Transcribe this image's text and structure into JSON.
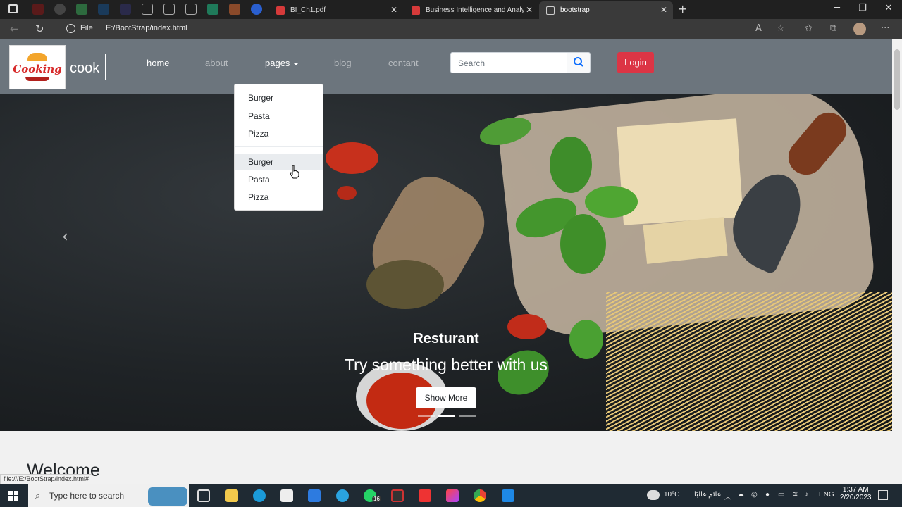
{
  "browser": {
    "tabs": [
      {
        "title": "BI_Ch1.pdf"
      },
      {
        "title": "Business Intelligence and Analytic"
      },
      {
        "title": "bootstrap"
      }
    ],
    "file_label": "File",
    "url": "E:/BootStrap/index.html",
    "status_url": "file:///E:/BootStrap/index.html#"
  },
  "navbar": {
    "brand": "cook",
    "logo_text": "Cooking",
    "links": [
      "home",
      "about",
      "pages",
      "blog",
      "contant"
    ],
    "search_placeholder": "Search",
    "login_label": "Login"
  },
  "dropdown": {
    "items": [
      "Burger",
      "Pasta",
      "Pizza",
      "Burger",
      "Pasta",
      "Pizza"
    ]
  },
  "carousel": {
    "title": "Resturant",
    "subtitle": "Try something better with us",
    "button_label": "Show More"
  },
  "section": {
    "heading": "Welcome"
  },
  "taskbar": {
    "search_placeholder": "Type here to search",
    "weather": "10°C",
    "weather_desc": "غائم غالبًا",
    "language": "ENG",
    "time": "1:37 AM",
    "date": "2/20/2023",
    "whatsapp_badge": "16"
  },
  "colors": {
    "navbar_bg": "#6c757d",
    "login_bg": "#dc3545",
    "search_icon": "#0d6efd"
  }
}
